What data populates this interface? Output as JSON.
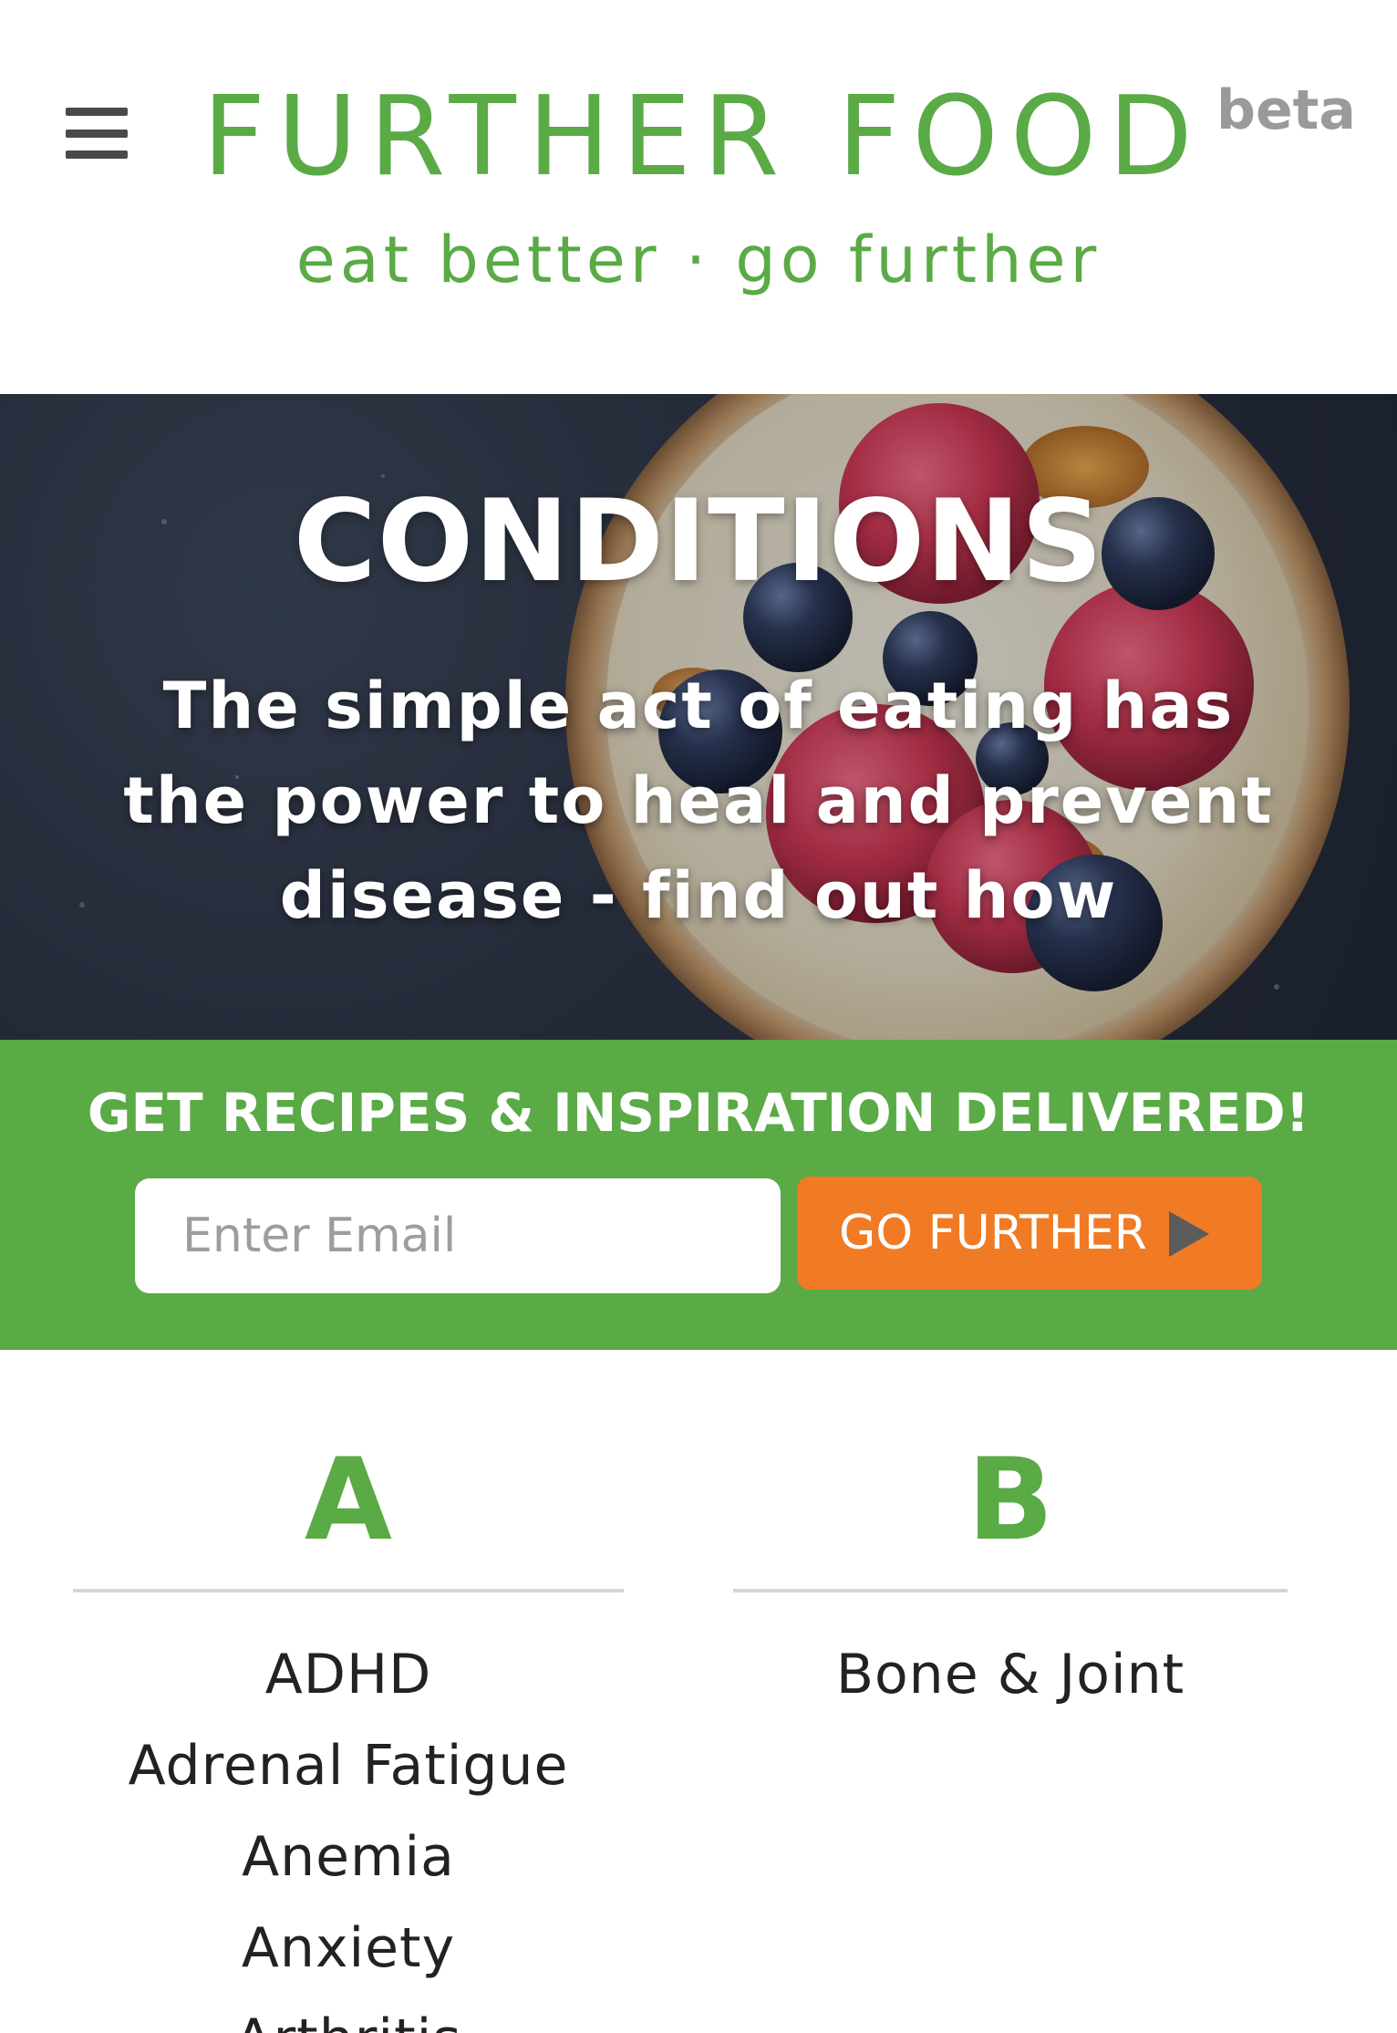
{
  "header": {
    "logo": "FURTHER FOOD",
    "beta": "beta",
    "tagline": "eat better · go further"
  },
  "hero": {
    "title": "CONDITIONS",
    "subtitle": "The simple act of eating has the power to heal and prevent disease - find out how"
  },
  "signup": {
    "title": "GET RECIPES & INSPIRATION DELIVERED!",
    "email_placeholder": "Enter Email",
    "button_label": "GO FURTHER"
  },
  "columns": [
    {
      "letter": "A",
      "items": [
        "ADHD",
        "Adrenal Fatigue",
        "Anemia",
        "Anxiety",
        "Arthritis"
      ]
    },
    {
      "letter": "B",
      "items": [
        "Bone & Joint"
      ]
    }
  ],
  "colors": {
    "brand_green": "#5aaa46",
    "cta_orange": "#f07b24"
  }
}
